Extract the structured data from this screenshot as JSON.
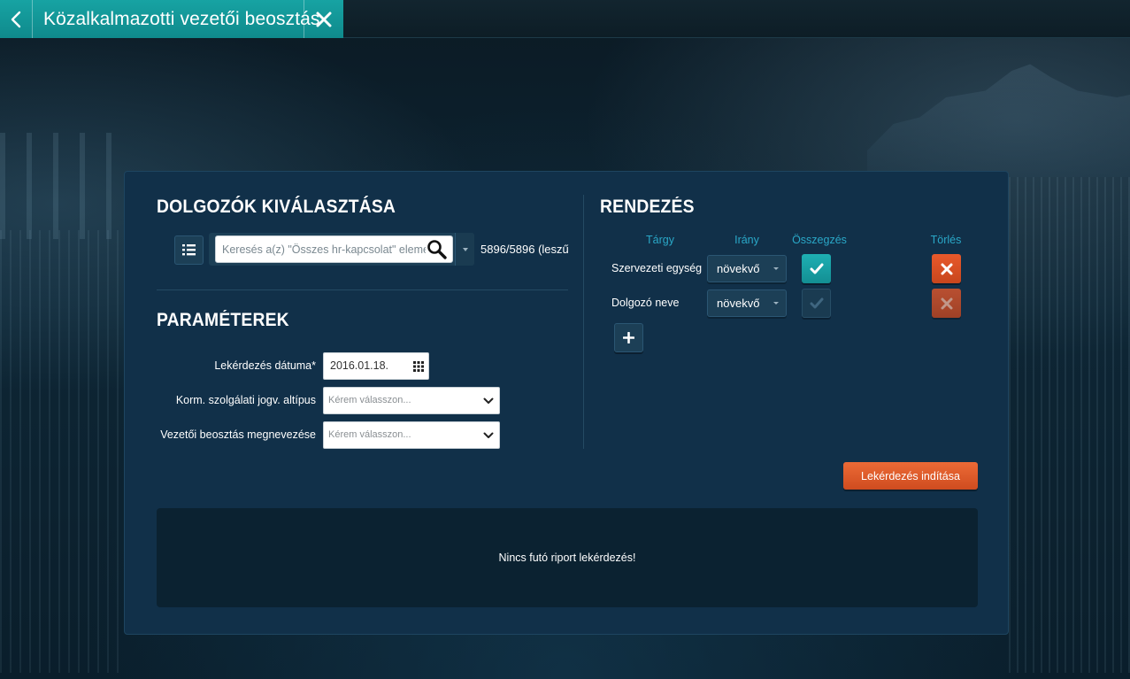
{
  "window": {
    "tab_title": "Közalkalmazotti vezetői beosztás"
  },
  "employees": {
    "title": "DOLGOZÓK KIVÁLASZTÁSA",
    "search_placeholder": "Keresés a(z) \"Összes hr-kapcsolat\" eleme",
    "count_text": "5896/5896 (leszű"
  },
  "params": {
    "title": "PARAMÉTEREK",
    "date_label": "Lekérdezés dátuma*",
    "date_value": "2016.01.18.",
    "kind_label": "Korm. szolgálati jogv. altípus",
    "kind_placeholder": "Kérem válasszon...",
    "position_label": "Vezetői beosztás megnevezése",
    "position_placeholder": "Kérem válasszon..."
  },
  "sorting": {
    "title": "RENDEZÉS",
    "col_subject": "Tárgy",
    "col_direction": "Irány",
    "col_summary": "Összegzés",
    "col_delete": "Törlés",
    "rows": [
      {
        "label": "Szervezeti egység",
        "direction": "növekvő",
        "summary": true
      },
      {
        "label": "Dolgozó neve",
        "direction": "növekvő",
        "summary": false
      }
    ]
  },
  "actions": {
    "run_label": "Lekérdezés indítása"
  },
  "report": {
    "message": "Nincs futó riport lekérdezés!"
  },
  "icons": {
    "back": "chevron-left-icon",
    "close": "close-icon",
    "list": "list-icon",
    "search": "search-icon",
    "calendar": "calendar-icon",
    "check": "check-icon",
    "delete": "close-icon",
    "add": "plus-icon"
  },
  "colors": {
    "accent_teal": "#17a3a3",
    "danger_orange": "#e8592b",
    "panel_bg": "#113049",
    "column_header": "#2aa8c8"
  }
}
